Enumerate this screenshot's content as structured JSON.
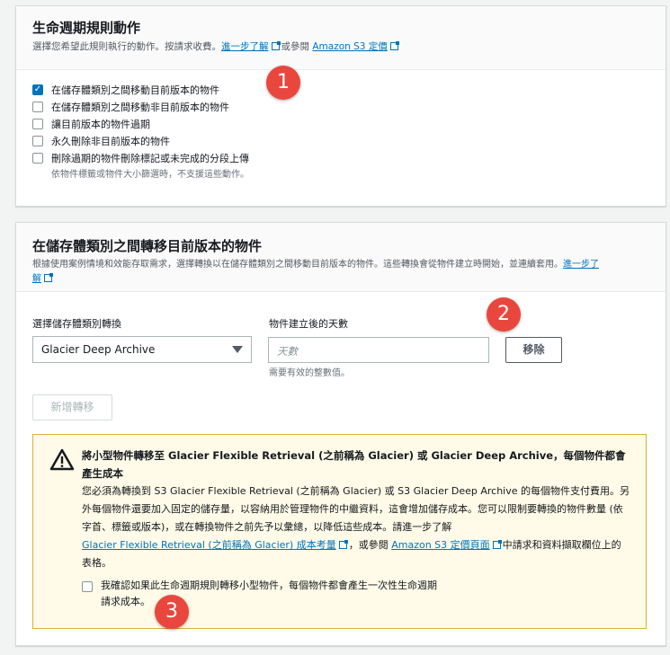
{
  "actions": {
    "title": "生命週期規則動作",
    "desc_prefix": "選擇您希望此規則執行的動作。按請求收費。",
    "learn_more": "進一步了解",
    "desc_mid": "或參閱",
    "pricing": "Amazon S3 定價",
    "options": [
      {
        "label": "在儲存體類別之間移動目前版本的物件",
        "checked": true
      },
      {
        "label": "在儲存體類別之間移動非目前版本的物件",
        "checked": false
      },
      {
        "label": "讓目前版本的物件過期",
        "checked": false
      },
      {
        "label": "永久刪除非目前版本的物件",
        "checked": false
      },
      {
        "label": "刪除過期的物件刪除標記或未完成的分段上傳",
        "checked": false
      }
    ],
    "option_note": "依物件標籤或物件大小篩選時，不支援這些動作。"
  },
  "transition": {
    "title": "在儲存體類別之間轉移目前版本的物件",
    "desc": "根據使用案例情境和效能存取需求，選擇轉換以在儲存體類別之間移動目前版本的物件。這些轉換會從物件建立時開始，並連續套用。",
    "learn_more_1": "進一步了",
    "learn_more_2": "解",
    "select_label": "選擇儲存體類別轉換",
    "select_value": "Glacier Deep Archive",
    "days_label": "物件建立後的天數",
    "days_placeholder": "天數",
    "days_hint": "需要有效的整數值。",
    "remove": "移除",
    "add": "新增轉移"
  },
  "warning": {
    "title": "將小型物件轉移至 Glacier Flexible Retrieval (之前稱為 Glacier) 或 Glacier Deep Archive，每個物件都會產生成本",
    "body": "您必須為轉換到 S3 Glacier Flexible Retrieval (之前稱為 Glacier) 或 S3 Glacier Deep Archive 的每個物件支付費用。另外每個物件還要加入固定的儲存量，以容納用於管理物件的中繼資料，這會增加儲存成本。您可以限制要轉換的物件數量 (依字首、標籤或版本)，或在轉換物件之前先予以彙總，以降低這些成本。請進一步了解",
    "link1": "Glacier Flexible Retrieval (之前稱為 Glacier) 成本考量",
    "mid": "，或參閱",
    "link2": "Amazon S3 定價頁面",
    "tail": "中請求和資料擷取欄位上的表格。",
    "ack_1": "我確認如果此生命週期規則轉移小型物件，每個物件都會產生一次性生命週期",
    "ack_2": "請求成本。"
  },
  "badges": [
    "1",
    "2",
    "3"
  ],
  "colors": {
    "accent": "#0073bb",
    "badge": "#e9473d",
    "warning_bg": "#fffbe8"
  }
}
